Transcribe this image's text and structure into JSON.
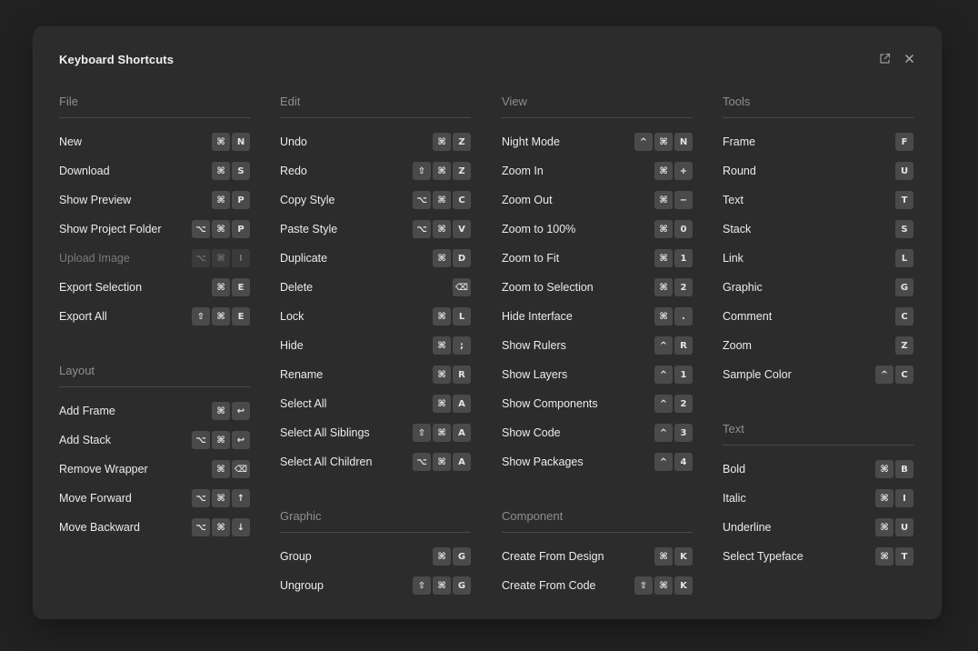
{
  "window": {
    "title": "Keyboard Shortcuts"
  },
  "header_icons": [
    {
      "name": "open-external-icon"
    },
    {
      "name": "close-icon"
    }
  ],
  "columns": [
    [
      {
        "title": "File",
        "items": [
          {
            "label": "New",
            "keys": [
              "⌘",
              "N"
            ]
          },
          {
            "label": "Download",
            "keys": [
              "⌘",
              "S"
            ]
          },
          {
            "label": "Show Preview",
            "keys": [
              "⌘",
              "P"
            ]
          },
          {
            "label": "Show Project Folder",
            "keys": [
              "⌥",
              "⌘",
              "P"
            ]
          },
          {
            "label": "Upload Image",
            "keys": [
              "⌥",
              "⌘",
              "I"
            ],
            "disabled": true
          },
          {
            "label": "Export Selection",
            "keys": [
              "⌘",
              "E"
            ]
          },
          {
            "label": "Export All",
            "keys": [
              "⇧",
              "⌘",
              "E"
            ]
          }
        ]
      },
      {
        "title": "Layout",
        "items": [
          {
            "label": "Add Frame",
            "keys": [
              "⌘",
              "↩"
            ]
          },
          {
            "label": "Add Stack",
            "keys": [
              "⌥",
              "⌘",
              "↩"
            ]
          },
          {
            "label": "Remove Wrapper",
            "keys": [
              "⌘",
              "⌫"
            ]
          },
          {
            "label": "Move Forward",
            "keys": [
              "⌥",
              "⌘",
              "↑"
            ]
          },
          {
            "label": "Move Backward",
            "keys": [
              "⌥",
              "⌘",
              "↓"
            ]
          }
        ]
      }
    ],
    [
      {
        "title": "Edit",
        "items": [
          {
            "label": "Undo",
            "keys": [
              "⌘",
              "Z"
            ]
          },
          {
            "label": "Redo",
            "keys": [
              "⇧",
              "⌘",
              "Z"
            ]
          },
          {
            "label": "Copy Style",
            "keys": [
              "⌥",
              "⌘",
              "C"
            ]
          },
          {
            "label": "Paste Style",
            "keys": [
              "⌥",
              "⌘",
              "V"
            ]
          },
          {
            "label": "Duplicate",
            "keys": [
              "⌘",
              "D"
            ]
          },
          {
            "label": "Delete",
            "keys": [
              "⌫"
            ]
          },
          {
            "label": "Lock",
            "keys": [
              "⌘",
              "L"
            ]
          },
          {
            "label": "Hide",
            "keys": [
              "⌘",
              ";"
            ]
          },
          {
            "label": "Rename",
            "keys": [
              "⌘",
              "R"
            ]
          },
          {
            "label": "Select All",
            "keys": [
              "⌘",
              "A"
            ]
          },
          {
            "label": "Select All Siblings",
            "keys": [
              "⇧",
              "⌘",
              "A"
            ]
          },
          {
            "label": "Select All Children",
            "keys": [
              "⌥",
              "⌘",
              "A"
            ]
          }
        ]
      },
      {
        "title": "Graphic",
        "items": [
          {
            "label": "Group",
            "keys": [
              "⌘",
              "G"
            ]
          },
          {
            "label": "Ungroup",
            "keys": [
              "⇧",
              "⌘",
              "G"
            ]
          }
        ]
      }
    ],
    [
      {
        "title": "View",
        "items": [
          {
            "label": "Night Mode",
            "keys": [
              "^",
              "⌘",
              "N"
            ]
          },
          {
            "label": "Zoom In",
            "keys": [
              "⌘",
              "+"
            ]
          },
          {
            "label": "Zoom Out",
            "keys": [
              "⌘",
              "−"
            ]
          },
          {
            "label": "Zoom to 100%",
            "keys": [
              "⌘",
              "0"
            ]
          },
          {
            "label": "Zoom to Fit",
            "keys": [
              "⌘",
              "1"
            ]
          },
          {
            "label": "Zoom to Selection",
            "keys": [
              "⌘",
              "2"
            ]
          },
          {
            "label": "Hide Interface",
            "keys": [
              "⌘",
              "."
            ]
          },
          {
            "label": "Show Rulers",
            "keys": [
              "^",
              "R"
            ]
          },
          {
            "label": "Show Layers",
            "keys": [
              "^",
              "1"
            ]
          },
          {
            "label": "Show Components",
            "keys": [
              "^",
              "2"
            ]
          },
          {
            "label": "Show Code",
            "keys": [
              "^",
              "3"
            ]
          },
          {
            "label": "Show Packages",
            "keys": [
              "^",
              "4"
            ]
          }
        ]
      },
      {
        "title": "Component",
        "items": [
          {
            "label": "Create From Design",
            "keys": [
              "⌘",
              "K"
            ]
          },
          {
            "label": "Create From Code",
            "keys": [
              "⇧",
              "⌘",
              "K"
            ]
          }
        ]
      }
    ],
    [
      {
        "title": "Tools",
        "items": [
          {
            "label": "Frame",
            "keys": [
              "F"
            ]
          },
          {
            "label": "Round",
            "keys": [
              "U"
            ]
          },
          {
            "label": "Text",
            "keys": [
              "T"
            ]
          },
          {
            "label": "Stack",
            "keys": [
              "S"
            ]
          },
          {
            "label": "Link",
            "keys": [
              "L"
            ]
          },
          {
            "label": "Graphic",
            "keys": [
              "G"
            ]
          },
          {
            "label": "Comment",
            "keys": [
              "C"
            ]
          },
          {
            "label": "Zoom",
            "keys": [
              "Z"
            ]
          },
          {
            "label": "Sample Color",
            "keys": [
              "^",
              "C"
            ]
          }
        ]
      },
      {
        "title": "Text",
        "items": [
          {
            "label": "Bold",
            "keys": [
              "⌘",
              "B"
            ]
          },
          {
            "label": "Italic",
            "keys": [
              "⌘",
              "I"
            ]
          },
          {
            "label": "Underline",
            "keys": [
              "⌘",
              "U"
            ]
          },
          {
            "label": "Select Typeface",
            "keys": [
              "⌘",
              "T"
            ]
          }
        ]
      }
    ]
  ]
}
